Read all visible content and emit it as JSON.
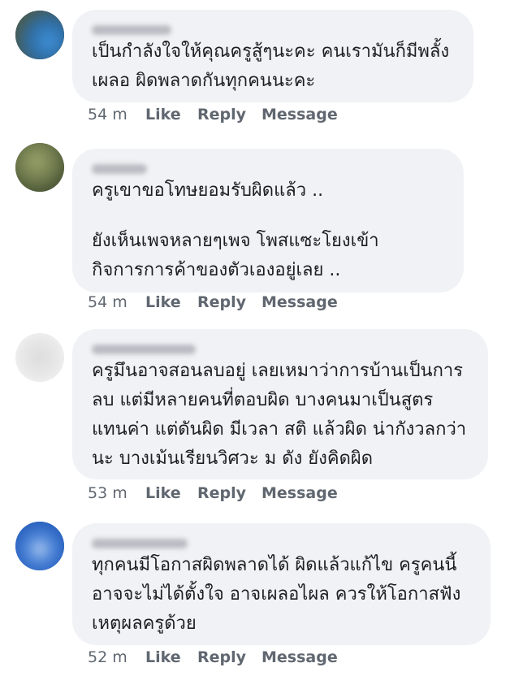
{
  "comments": [
    {
      "author": "",
      "lines": [
        "เป็นกำลังใจให้คุณครูสู้ๆนะคะ คนเรามันก็มีพลั้ง",
        "เผลอ ผิดพลาดกันทุกคนนะคะ"
      ],
      "time": "54 m",
      "like": "Like",
      "reply": "Reply",
      "message": "Message"
    },
    {
      "author": "",
      "lines": [
        "ครูเขาขอโทษยอมรับผิดแล้ว ..",
        "",
        "ยังเห็นเพจหลายๆเพจ โพสแซะโยงเข้า",
        "กิจการการค้าของตัวเองอยู่เลย .."
      ],
      "time": "54 m",
      "like": "Like",
      "reply": "Reply",
      "message": "Message"
    },
    {
      "author": "",
      "lines": [
        "ครูมึนอาจสอนลบอยู่ เลยเหมาว่าการบ้านเป็นการ",
        "ลบ แต่มีหลายคนที่ตอบผิด บางคนมาเป็นสูตร",
        "แทนค่า แต่ดันผิด มีเวลา สติ แล้วผิด น่ากังวลกว่า",
        "นะ  บางเม้นเรียนวิศวะ ม ดัง ยังคิดผิด"
      ],
      "time": "53 m",
      "like": "Like",
      "reply": "Reply",
      "message": "Message"
    },
    {
      "author": "",
      "lines": [
        "ทุกคนมีโอกาสผิดพลาดได้  ผิดแล้วแก้ไข  ครูคนนี้",
        "อาจจะไม่ได้ตั้งใจ อาจเผลอไผล  ควรให้โอกาสฟัง",
        "เหตุผลครูด้วย"
      ],
      "time": "52 m",
      "like": "Like",
      "reply": "Reply",
      "message": "Message"
    }
  ],
  "colors": {
    "bubble": "#f0f2f5",
    "text": "#1c1e21",
    "meta": "#606770"
  }
}
